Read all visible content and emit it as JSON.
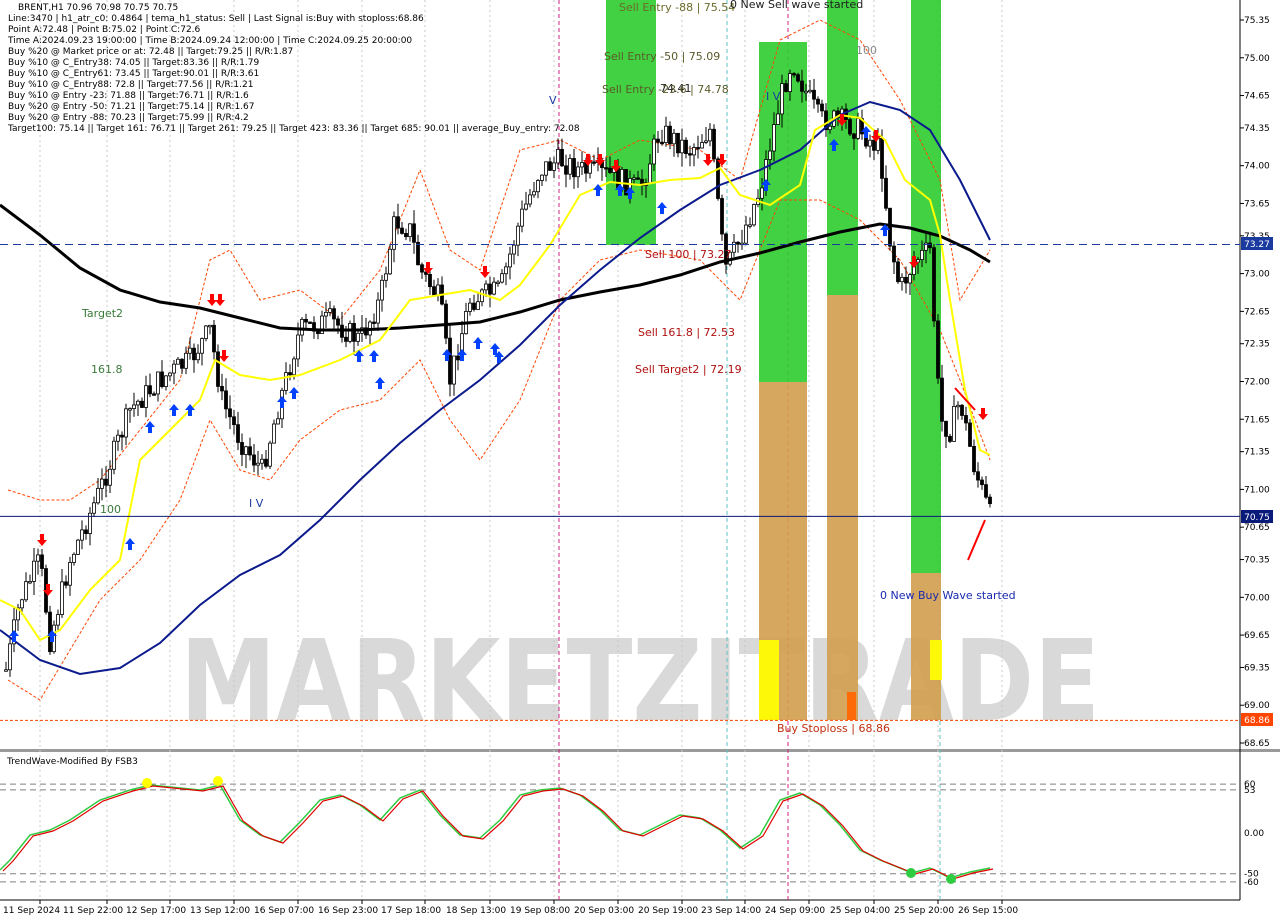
{
  "header": {
    "symbol_line": "BRENT,H1  70.96 70.98 70.75 70.75",
    "lines": [
      "Line:3470  |  h1_atr_c0: 0.4864  |  tema_h1_status: Sell  |  Last Signal is:Buy with stoploss:68.86",
      "Point A:72.48  |  Point B:75.02  |  Point C:72.6",
      "Time A:2024.09.23 19:00:00  |  Time B:2024.09.24 12:00:00  |  Time C:2024.09.25 20:00:00",
      "Buy %20 @ Market price or at: 72.48  ||  Target:79.25  ||  R/R:1.87",
      "Buy %10 @ C_Entry38: 74.05  ||  Target:83.36  ||  R/R:1.79",
      "Buy %10 @ C_Entry61: 73.45  ||  Target:90.01  ||  R/R:3.61",
      "Buy %10 @ C_Entry88: 72.8  ||  Target:77.56  ||  R/R:1.21",
      "Buy %10 @ Entry -23: 71.88  ||  Target:76.71  ||  R/R:1.6",
      "Buy %20 @ Entry -50: 71.21  ||  Target:75.14  ||  R/R:1.67",
      "Buy %20 @ Entry -88: 70.23  ||  Target:75.99  ||  R/R:4.2",
      "Target100: 75.14  ||  Target 161: 76.71  ||  Target 261: 79.25  ||  Target 423: 83.36  ||  Target 685: 90.01  ||  average_Buy_entry: 72.08"
    ]
  },
  "watermark": "MARKETZITRADE",
  "indicator_title": "TrendWave-Modified By FSB3",
  "colors": {
    "bull_candle": "#000000",
    "bear_candle": "#000000",
    "ema_slow": "#000000",
    "ema_mid": "#0b1a8c",
    "tema": "#ffff00",
    "channel": "#ff4500",
    "green_zone": "#32cd32",
    "orange_zone": "#d2a050",
    "buy_arrow": "#0040ff",
    "sell_arrow": "#ff0000",
    "price_tag": "#0a1a7a",
    "stop_tag": "#ff4500",
    "wave_green": "#2ecc40",
    "wave_red": "#e00000"
  },
  "price_axis": {
    "min": 68.65,
    "max": 75.35,
    "ticks": [
      "75.35",
      "75.00",
      "74.65",
      "74.35",
      "74.00",
      "73.65",
      "73.35",
      "73.00",
      "72.65",
      "72.35",
      "72.00",
      "71.65",
      "71.35",
      "71.00",
      "70.65",
      "70.35",
      "70.00",
      "69.65",
      "69.35",
      "69.00",
      "68.65"
    ],
    "current_price": "70.75",
    "line_price": "73.27",
    "stop_price": "68.86"
  },
  "time_axis": [
    "11 Sep 2024",
    "11 Sep 22:00",
    "12 Sep 17:00",
    "13 Sep 12:00",
    "16 Sep 07:00",
    "16 Sep 23:00",
    "17 Sep 18:00",
    "18 Sep 13:00",
    "19 Sep 08:00",
    "20 Sep 03:00",
    "20 Sep 19:00",
    "23 Sep 14:00",
    "24 Sep 09:00",
    "25 Sep 04:00",
    "25 Sep 20:00",
    "26 Sep 15:00"
  ],
  "indicator_axis": [
    "60",
    "53",
    "0.00",
    "-50",
    "-60"
  ],
  "annotations": {
    "sell_entry_88": "Sell Entry -88 | 75.54",
    "sell_entry_50": "Sell Entry -50 | 75.09",
    "sell_entry_23": "Sell Entry -23.6 | 74.78",
    "label_7441": "74.41",
    "new_sell_wave": "0 New Sell wave started",
    "label_100_top": "100",
    "sell_100": "Sell 100 | 73.27",
    "sell_1618": "Sell 161.8 | 72.53",
    "sell_target2": "Sell Target2 | 72.19",
    "target2": "Target2",
    "fib_1618": "161.8",
    "label_100_left": "100",
    "wave_v": "V",
    "wave_iv_top": "I V",
    "wave_iv_bottom": "I V",
    "new_buy_wave": "0 New Buy Wave started",
    "buy_stoploss": "Buy Stoploss | 68.86"
  },
  "chart_data": {
    "type": "candlestick",
    "title": "BRENT,H1",
    "ylim": [
      68.65,
      75.35
    ],
    "series": [
      {
        "name": "price (approx. path)",
        "x": [
          "11 Sep 2024",
          "11 Sep 22:00",
          "12 Sep 17:00",
          "13 Sep 12:00",
          "16 Sep 07:00",
          "16 Sep 23:00",
          "17 Sep 18:00",
          "18 Sep 13:00",
          "19 Sep 08:00",
          "20 Sep 03:00",
          "20 Sep 19:00",
          "23 Sep 14:00",
          "24 Sep 09:00",
          "25 Sep 04:00",
          "25 Sep 20:00",
          "26 Sep 15:00"
        ],
        "values": [
          69.4,
          70.5,
          71.8,
          72.5,
          71.5,
          72.6,
          73.0,
          72.3,
          74.0,
          73.8,
          74.2,
          73.1,
          74.9,
          74.3,
          72.9,
          70.75
        ]
      },
      {
        "name": "ema_slow (approx.)",
        "values": [
          73.55,
          72.95,
          72.8,
          72.65,
          72.55,
          72.55,
          72.6,
          72.62,
          72.7,
          72.9,
          73.05,
          73.15,
          73.25,
          73.4,
          73.45,
          73.1
        ]
      },
      {
        "name": "ema_mid (approx.)",
        "values": [
          69.7,
          69.3,
          69.6,
          70.2,
          70.8,
          71.4,
          71.9,
          72.1,
          72.6,
          73.2,
          73.7,
          74.0,
          74.3,
          74.65,
          74.4,
          73.3
        ]
      }
    ],
    "indicator": {
      "name": "TrendWave-Modified By FSB3",
      "ylim": [
        -70,
        70
      ],
      "levels": [
        60,
        53,
        0,
        -50,
        -60
      ]
    }
  }
}
